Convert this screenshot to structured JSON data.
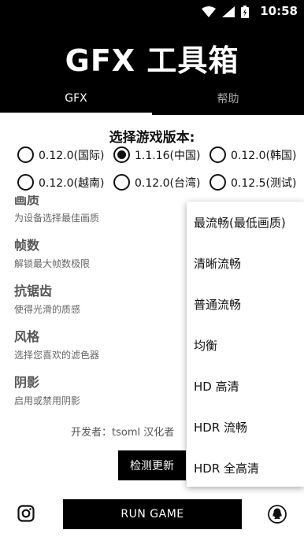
{
  "status_bar": {
    "time": "10:58"
  },
  "header": {
    "title": "GFX 工具箱"
  },
  "tabs": [
    {
      "label": "GFX"
    },
    {
      "label": "帮助"
    }
  ],
  "version_section": {
    "title": "选择游戏版本:",
    "options": [
      {
        "label": "0.12.0(国际)",
        "checked": false
      },
      {
        "label": "1.1.16(中国)",
        "checked": true
      },
      {
        "label": "0.12.0(韩国)",
        "checked": false
      },
      {
        "label": "0.12.0(越南)",
        "checked": false
      },
      {
        "label": "0.12.0(台湾)",
        "checked": false
      },
      {
        "label": "0.12.5(测试)",
        "checked": false
      }
    ]
  },
  "settings": [
    {
      "title": "画质",
      "desc": "为设备选择最佳画质"
    },
    {
      "title": "帧数",
      "desc": "解锁最大帧数极限"
    },
    {
      "title": "抗锯齿",
      "desc": "使得光滑的质感"
    },
    {
      "title": "风格",
      "desc": "选择您喜欢的滤色器"
    },
    {
      "title": "阴影",
      "desc": "启用或禁用阴影"
    }
  ],
  "developer_line": "开发者：tsoml   汉化者",
  "update_button": "检测更新",
  "dropdown": {
    "options": [
      "最流畅(最低画质)",
      "清晰流畅",
      "普通流畅",
      "均衡",
      "HD 高清",
      "HDR 流畅",
      "HDR 全高清"
    ]
  },
  "run_button": "RUN GAME",
  "icons": {
    "left": "instagram-icon",
    "right": "qq-icon"
  }
}
